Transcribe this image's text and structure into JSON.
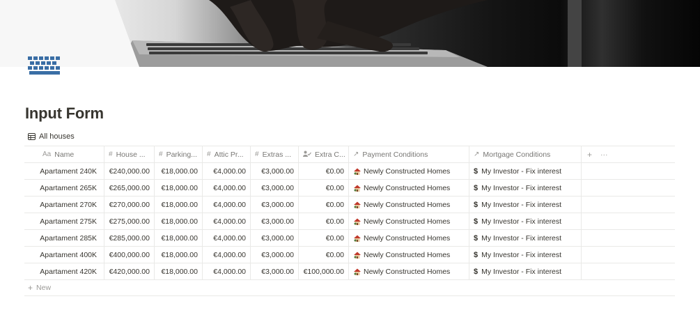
{
  "page": {
    "title": "Input Form",
    "view_tab": "All houses",
    "icons": {
      "cover": "laptop-typing-photo",
      "page_icon": "keyboard-icon"
    }
  },
  "table": {
    "columns": [
      {
        "label": "Name",
        "icon": "Aa"
      },
      {
        "label": "House ...",
        "icon": "#"
      },
      {
        "label": "Parking...",
        "icon": "#"
      },
      {
        "label": "Attic Pr...",
        "icon": "#"
      },
      {
        "label": "Extras ...",
        "icon": "#"
      },
      {
        "label": "Extra C...",
        "icon": "rollup-icon"
      },
      {
        "label": "Payment Conditions",
        "icon": "↗"
      },
      {
        "label": "Mortgage Conditions",
        "icon": "↗"
      }
    ],
    "rows": [
      {
        "name": "Apartament 240K",
        "house": "€240,000.00",
        "parking": "€18,000.00",
        "attic": "€4,000.00",
        "extras": "€3,000.00",
        "extra_c": "€0.00",
        "payment": "Newly Constructed Homes",
        "mortgage": "My Investor - Fix interest"
      },
      {
        "name": "Apartament 265K",
        "house": "€265,000.00",
        "parking": "€18,000.00",
        "attic": "€4,000.00",
        "extras": "€3,000.00",
        "extra_c": "€0.00",
        "payment": "Newly Constructed Homes",
        "mortgage": "My Investor - Fix interest"
      },
      {
        "name": "Apartament 270K",
        "house": "€270,000.00",
        "parking": "€18,000.00",
        "attic": "€4,000.00",
        "extras": "€3,000.00",
        "extra_c": "€0.00",
        "payment": "Newly Constructed Homes",
        "mortgage": "My Investor - Fix interest"
      },
      {
        "name": "Apartament 275K",
        "house": "€275,000.00",
        "parking": "€18,000.00",
        "attic": "€4,000.00",
        "extras": "€3,000.00",
        "extra_c": "€0.00",
        "payment": "Newly Constructed Homes",
        "mortgage": "My Investor - Fix interest"
      },
      {
        "name": "Apartament 285K",
        "house": "€285,000.00",
        "parking": "€18,000.00",
        "attic": "€4,000.00",
        "extras": "€3,000.00",
        "extra_c": "€0.00",
        "payment": "Newly Constructed Homes",
        "mortgage": "My Investor - Fix interest"
      },
      {
        "name": "Apartament 400K",
        "house": "€400,000.00",
        "parking": "€18,000.00",
        "attic": "€4,000.00",
        "extras": "€3,000.00",
        "extra_c": "€0.00",
        "payment": "Newly Constructed Homes",
        "mortgage": "My Investor - Fix interest"
      },
      {
        "name": "Apartament 420K",
        "house": "€420,000.00",
        "parking": "€18,000.00",
        "attic": "€4,000.00",
        "extras": "€3,000.00",
        "extra_c": "€100,000.00",
        "payment": "Newly Constructed Homes",
        "mortgage": "My Investor - Fix interest"
      }
    ],
    "add_column": "+",
    "more": "···",
    "new_row_label": "New",
    "payment_icon": "house-icon",
    "mortgage_icon": "$"
  }
}
